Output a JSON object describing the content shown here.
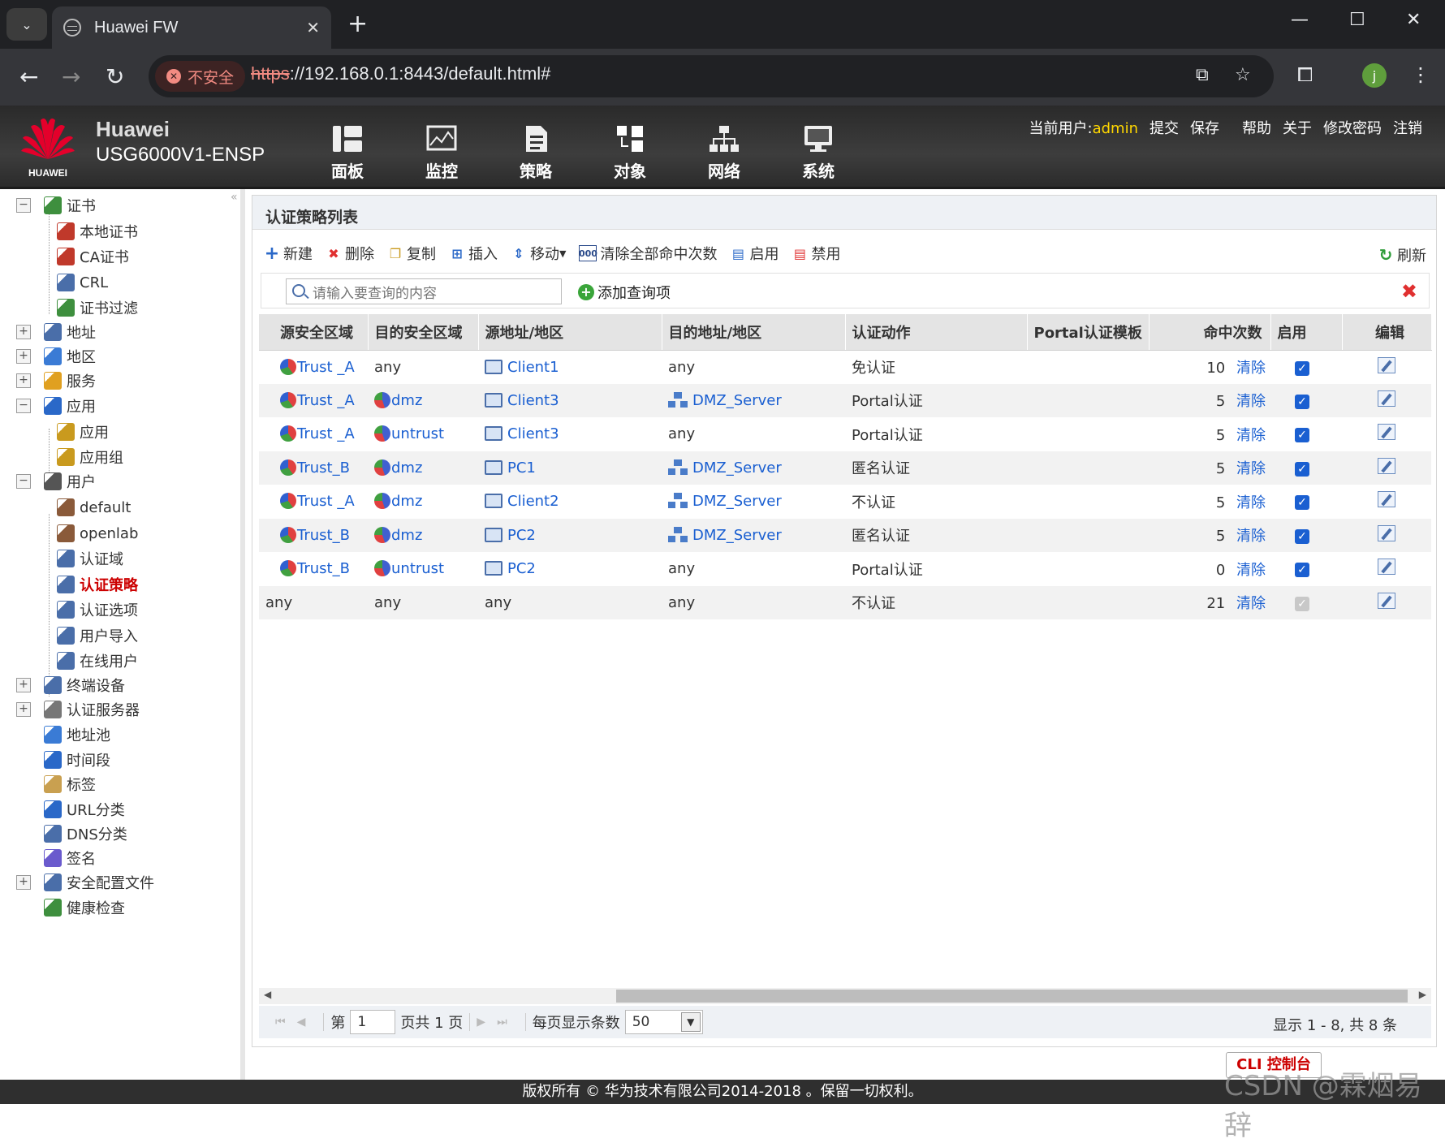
{
  "browser": {
    "tab_title": "Huawei FW",
    "insecure_label": "不安全",
    "url_scheme": "https",
    "url_rest": "://192.168.0.1:8443/default.html#",
    "profile_initial": "j"
  },
  "header": {
    "brand_line1": "Huawei",
    "brand_line2": "USG6000V1-ENSP",
    "logo_text": "HUAWEI",
    "nav": [
      {
        "label": "面板",
        "icon": "dashboard-icon"
      },
      {
        "label": "监控",
        "icon": "monitor-icon"
      },
      {
        "label": "策略",
        "icon": "policy-icon"
      },
      {
        "label": "对象",
        "icon": "object-icon"
      },
      {
        "label": "网络",
        "icon": "network-icon"
      },
      {
        "label": "系统",
        "icon": "system-icon"
      }
    ],
    "user_prefix": "当前用户:",
    "user_name": "admin",
    "links": [
      "提交",
      "保存",
      "帮助",
      "关于",
      "修改密码",
      "注销"
    ]
  },
  "sidebar": {
    "items": [
      {
        "label": "证书",
        "expander": "−"
      },
      {
        "label": "本地证书"
      },
      {
        "label": "CA证书"
      },
      {
        "label": "CRL"
      },
      {
        "label": "证书过滤"
      },
      {
        "label": "地址",
        "expander": "+"
      },
      {
        "label": "地区",
        "expander": "+"
      },
      {
        "label": "服务",
        "expander": "+"
      },
      {
        "label": "应用",
        "expander": "−"
      },
      {
        "label": "应用"
      },
      {
        "label": "应用组"
      },
      {
        "label": "用户",
        "expander": "−"
      },
      {
        "label": "default"
      },
      {
        "label": "openlab"
      },
      {
        "label": "认证域"
      },
      {
        "label": "认证策略"
      },
      {
        "label": "认证选项"
      },
      {
        "label": "用户导入"
      },
      {
        "label": "在线用户"
      },
      {
        "label": "终端设备",
        "expander": "+"
      },
      {
        "label": "认证服务器",
        "expander": "+"
      },
      {
        "label": "地址池"
      },
      {
        "label": "时间段"
      },
      {
        "label": "标签"
      },
      {
        "label": "URL分类"
      },
      {
        "label": "DNS分类"
      },
      {
        "label": "签名"
      },
      {
        "label": "安全配置文件",
        "expander": "+"
      },
      {
        "label": "健康检查"
      }
    ]
  },
  "panel": {
    "title": "认证策略列表",
    "toolbar": {
      "new": "新建",
      "delete": "删除",
      "copy": "复制",
      "insert": "插入",
      "move": "移动",
      "clear_all": "清除全部命中次数",
      "enable": "启用",
      "disable": "禁用",
      "refresh": "刷新"
    },
    "search_placeholder": "请输入要查询的内容",
    "add_query": "添加查询项",
    "columns": [
      "源安全区域",
      "目的安全区域",
      "源地址/地区",
      "目的地址/地区",
      "认证动作",
      "Portal认证模板",
      "命中次数",
      "启用",
      "编辑"
    ],
    "clear_label": "清除",
    "rows": [
      {
        "src_zone": "Trust _A",
        "dst_zone": "any",
        "src_addr": "Client1",
        "dst_addr": "any",
        "action": "免认证",
        "portal": "",
        "hits": "10",
        "enabled": true
      },
      {
        "src_zone": "Trust _A",
        "dst_zone": "dmz",
        "src_addr": "Client3",
        "dst_addr": "DMZ_Server",
        "action": "Portal认证",
        "portal": "",
        "hits": "5",
        "enabled": true
      },
      {
        "src_zone": "Trust _A",
        "dst_zone": "untrust",
        "src_addr": "Client3",
        "dst_addr": "any",
        "action": "Portal认证",
        "portal": "",
        "hits": "5",
        "enabled": true
      },
      {
        "src_zone": "Trust_B",
        "dst_zone": "dmz",
        "src_addr": "PC1",
        "dst_addr": "DMZ_Server",
        "action": "匿名认证",
        "portal": "",
        "hits": "5",
        "enabled": true
      },
      {
        "src_zone": "Trust _A",
        "dst_zone": "dmz",
        "src_addr": "Client2",
        "dst_addr": "DMZ_Server",
        "action": "不认证",
        "portal": "",
        "hits": "5",
        "enabled": true
      },
      {
        "src_zone": "Trust_B",
        "dst_zone": "dmz",
        "src_addr": "PC2",
        "dst_addr": "DMZ_Server",
        "action": "匿名认证",
        "portal": "",
        "hits": "5",
        "enabled": true
      },
      {
        "src_zone": "Trust_B",
        "dst_zone": "untrust",
        "src_addr": "PC2",
        "dst_addr": "any",
        "action": "Portal认证",
        "portal": "",
        "hits": "0",
        "enabled": true
      },
      {
        "src_zone": "any",
        "dst_zone": "any",
        "src_addr": "any",
        "dst_addr": "any",
        "action": "不认证",
        "portal": "",
        "hits": "21",
        "enabled": true,
        "default_rule": true
      }
    ],
    "pager": {
      "page_prefix": "第",
      "page_value": "1",
      "page_suffix": "页共 1 页",
      "page_size_label": "每页显示条数",
      "page_size_value": "50",
      "info": "显示 1 - 8, 共 8 条"
    }
  },
  "cli_button": "CLI 控制台",
  "footer": "版权所有 © 华为技术有限公司2014-2018 。保留一切权利。",
  "watermark": "CSDN @霖烟易辞"
}
